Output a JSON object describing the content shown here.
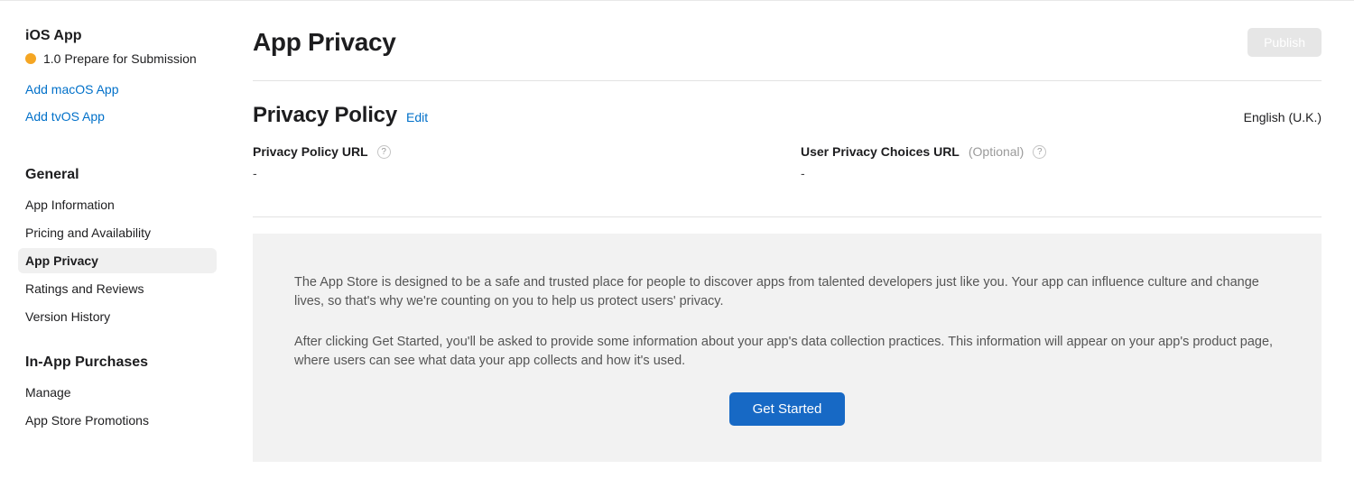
{
  "sidebar": {
    "app_platform": "iOS App",
    "status_text": "1.0 Prepare for Submission",
    "platform_links": [
      "Add macOS App",
      "Add tvOS App"
    ],
    "groups": [
      {
        "title": "General",
        "items": [
          {
            "label": "App Information",
            "active": false
          },
          {
            "label": "Pricing and Availability",
            "active": false
          },
          {
            "label": "App Privacy",
            "active": true
          },
          {
            "label": "Ratings and Reviews",
            "active": false
          },
          {
            "label": "Version History",
            "active": false
          }
        ]
      },
      {
        "title": "In-App Purchases",
        "items": [
          {
            "label": "Manage",
            "active": false
          },
          {
            "label": "App Store Promotions",
            "active": false
          }
        ]
      }
    ]
  },
  "header": {
    "title": "App Privacy",
    "publish_label": "Publish"
  },
  "privacy_policy": {
    "section_title": "Privacy Policy",
    "edit_label": "Edit",
    "locale": "English (U.K.)",
    "fields": {
      "policy_url": {
        "label": "Privacy Policy URL",
        "value": "-"
      },
      "choices_url": {
        "label": "User Privacy Choices URL",
        "optional": "(Optional)",
        "value": "-"
      }
    }
  },
  "info_panel": {
    "paragraph1": "The App Store is designed to be a safe and trusted place for people to discover apps from talented developers just like you. Your app can influence culture and change lives, so that's why we're counting on you to help us protect users' privacy.",
    "paragraph2": "After clicking Get Started, you'll be asked to provide some information about your app's data collection practices. This information will appear on your app's product page, where users can see what data your app collects and how it's used.",
    "button_label": "Get Started"
  }
}
